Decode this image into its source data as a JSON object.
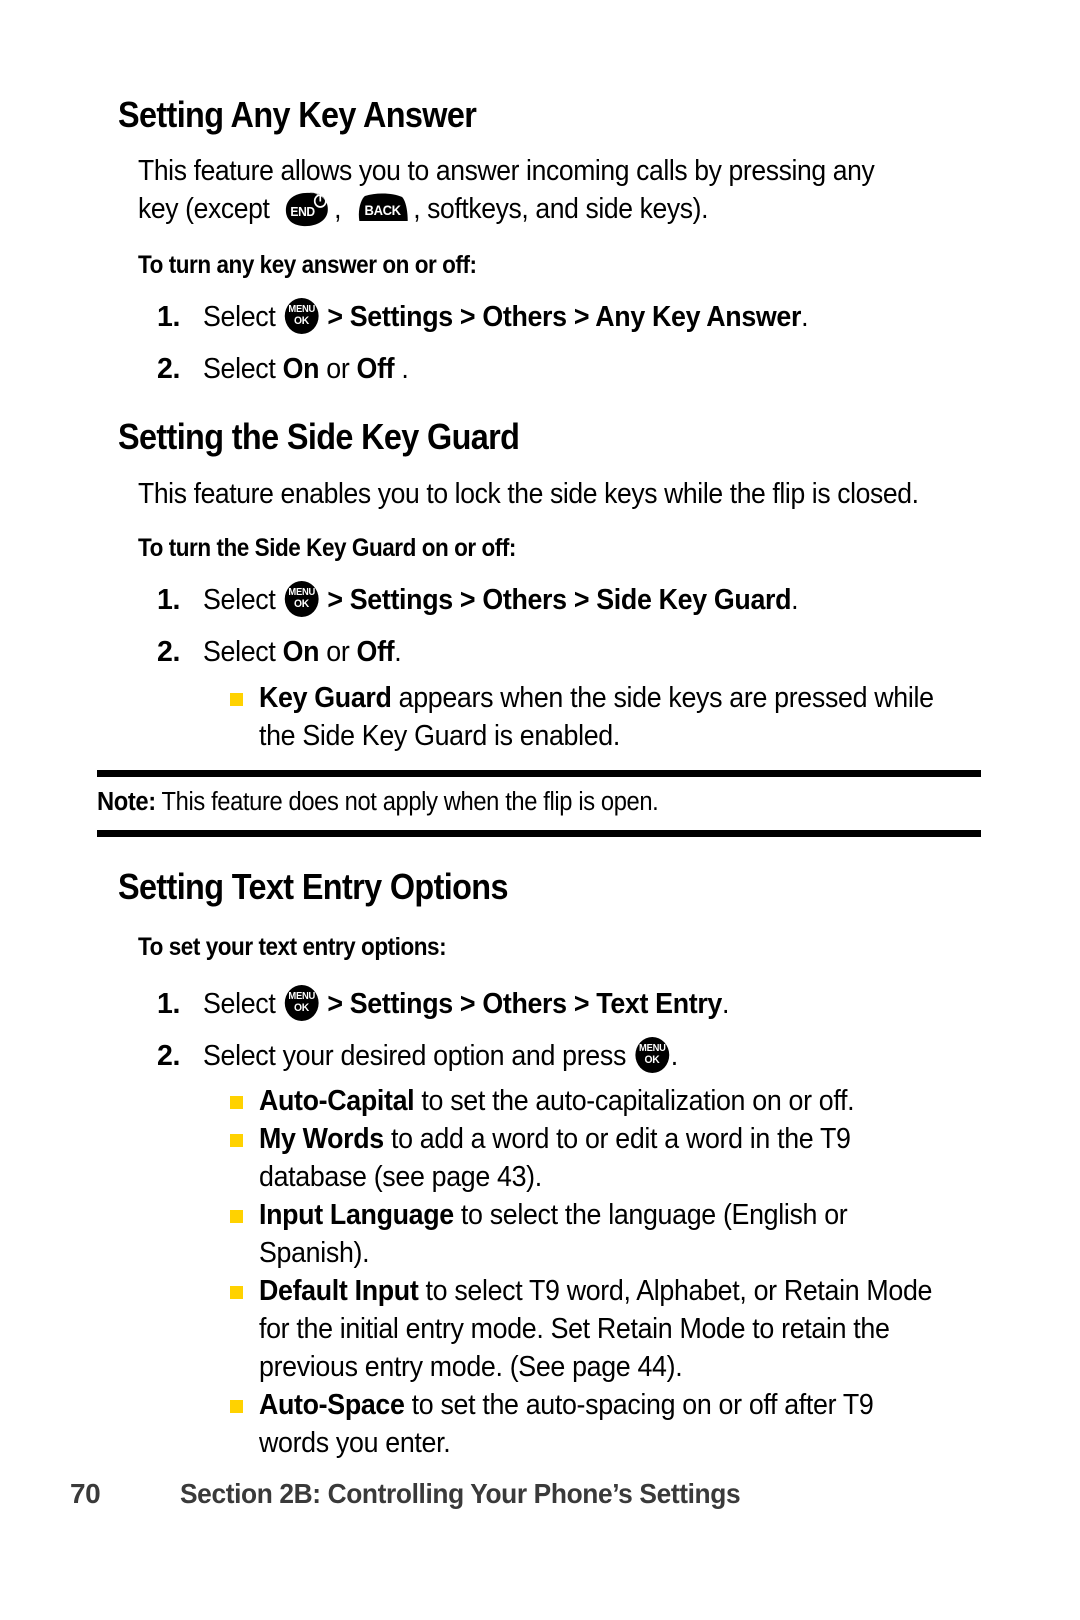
{
  "page": {
    "number": "70",
    "footer_title": "Section 2B: Controlling Your Phone’s Settings",
    "bullet_color": "#FFD200"
  },
  "sections": [
    {
      "title": "Setting Any Key Answer",
      "intro_part1": "This feature allows you to answer incoming calls by pressing any key (except ",
      "intro_part2": ", ",
      "intro_part3": ", softkeys, and side keys).",
      "subhead": "To turn any key answer on or off:",
      "steps": [
        {
          "num": "1.",
          "pre": "Select ",
          "icon": "menu-ok-key-icon",
          "path_prefix": " > ",
          "path_bold": "Settings > Others > Any Key Answer",
          "post": "."
        },
        {
          "num": "2.",
          "pre": "Select ",
          "bold_a": "On",
          "mid": " or ",
          "bold_b": "Off",
          "post": " ."
        }
      ]
    },
    {
      "title": "Setting the Side Key Guard",
      "intro": "This feature enables you to lock the side keys while the flip is closed.",
      "subhead": "To turn the Side Key Guard on or off:",
      "steps": [
        {
          "num": "1.",
          "pre": "Select ",
          "icon": "menu-ok-key-icon",
          "path_prefix": " > ",
          "path_bold": "Settings > Others > Side Key Guard",
          "post": "."
        },
        {
          "num": "2.",
          "pre": "Select ",
          "bold_a": "On",
          "mid": " or ",
          "bold_b": "Off",
          "post": "."
        }
      ],
      "bullets": [
        {
          "bold": "Key Guard",
          "text": " appears when the side keys are pressed while the Side Key Guard is enabled."
        }
      ]
    },
    {
      "title": "Setting Text Entry Options",
      "subhead": "To set your text entry options:",
      "steps": [
        {
          "num": "1.",
          "pre": "Select ",
          "icon": "menu-ok-key-icon",
          "path_prefix": " > ",
          "path_bold": "Settings > Others > Text Entry",
          "post": "."
        },
        {
          "num": "2.",
          "pre": "Select your desired option and press ",
          "icon": "menu-ok-key-icon",
          "post": "."
        }
      ],
      "bullets": [
        {
          "bold": "Auto-Capital",
          "text": " to set the auto-capitalization on or off."
        },
        {
          "bold": "My Words",
          "text": " to add a word to or edit a word in the T9 database (see page 43)."
        },
        {
          "bold": "Input Language",
          "text": " to select the language (English or Spanish)."
        },
        {
          "bold": "Default Input",
          "text": " to select T9 word, Alphabet, or Retain Mode for the initial entry mode. Set Retain Mode to retain the previous entry mode. (See page 44)."
        },
        {
          "bold": "Auto-Space",
          "text": " to set the auto-spacing on or off after T9 words you enter."
        }
      ]
    }
  ],
  "note": {
    "label": "Note:",
    "text": " This feature does not apply when the flip is open."
  },
  "icons": {
    "menu_line1": "MENU",
    "menu_line2": "OK",
    "end_label": "END",
    "back_label": "BACK"
  }
}
